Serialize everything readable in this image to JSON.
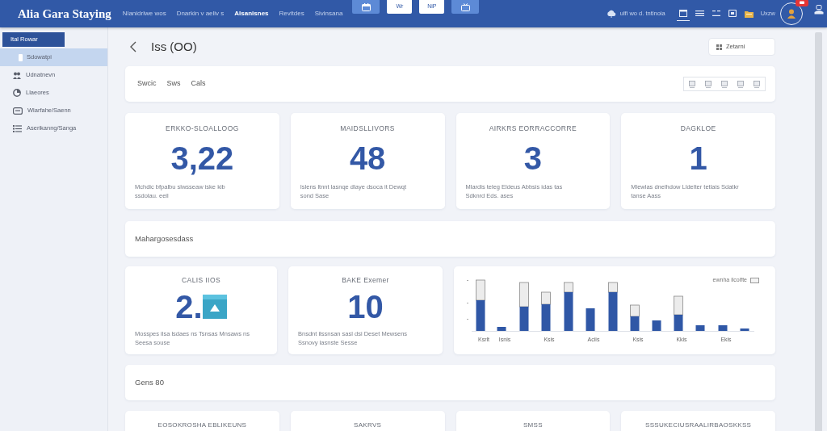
{
  "top_bar": {
    "logo": "Alia Gara Staying",
    "nav": [
      {
        "label": "Nlanidrlwe wos",
        "selected": false
      },
      {
        "label": "Dnarkin v aeliv s",
        "selected": false
      },
      {
        "label": "Alsanisnes",
        "selected": true
      },
      {
        "label": "Revitdes",
        "selected": false
      },
      {
        "label": "Sivinsana",
        "selected": false
      }
    ],
    "view_buttons": [
      {
        "kind": "icon"
      },
      {
        "kind": "text",
        "label": "Wr"
      },
      {
        "kind": "text",
        "label": "NiP"
      },
      {
        "kind": "icon"
      }
    ],
    "status": "ulfi wo d. tntlnoia",
    "tools": [
      {
        "selected": true
      },
      {
        "selected": false
      },
      {
        "selected": false
      },
      {
        "selected": false
      },
      {
        "selected": false
      }
    ],
    "user": "Uxzw"
  },
  "sidebar": {
    "heading": "Ital Rowar",
    "items": [
      {
        "label": "Sdowatpi",
        "selected": true
      },
      {
        "label": "Udnatnevn",
        "selected": false
      },
      {
        "label": "Llaeores",
        "selected": false
      },
      {
        "label": "Wlarfahe/Saenn",
        "selected": false
      },
      {
        "label": "Aserikanng/Sanga",
        "selected": false
      }
    ]
  },
  "page": {
    "title": "Iss (OO)",
    "action": "Zetarni",
    "tabs": [
      {
        "label": "Swcic",
        "selected": false
      },
      {
        "label": "Sws",
        "selected": false
      },
      {
        "label": "Cals",
        "selected": false
      }
    ]
  },
  "stats": [
    {
      "title": "ERKKO-SLOALLOOG",
      "value": "3,22",
      "description": "Mchdic bfpalbu slwsseaw iske kib ssdolau. eeil"
    },
    {
      "title": "MAIDSLLIVORS",
      "value": "48",
      "description": "Islens ltnnt lasnqe dlaye dsoca it Dewqt sond Sase"
    },
    {
      "title": "AIRKRS EORRACCORRE",
      "value": "3",
      "description": "Mlardis teleg Eldeus Abbsis idas tas Sdknrd Eds. ases"
    },
    {
      "title": "DAGKLOE",
      "value": "1",
      "description": "Mlewlas dnelhdow Lldelter tetlais Sdatkr tanse Aass"
    }
  ],
  "section_1": {
    "title": "Mahargosesdass",
    "cards": [
      {
        "kind": "image",
        "title": "CALIS IIOS",
        "value": "2.",
        "description": "Mosspes ilsa lsdaes ns Tsnsas Mnsaws ns Seesa souse"
      },
      {
        "kind": "number",
        "title": "BAKE Exemer",
        "value": "10",
        "description": "Bnsdnt ilssnsan sasl dsi Deset Mewsens Ssnovy lasnste Sesse"
      }
    ],
    "chart": {
      "legend": "ewnha ilcolfte",
      "x_labels": [
        "Ksrlt",
        "Isnis",
        "Ksis",
        "Aciis",
        "Ksis",
        "Kkis",
        "Ekis"
      ]
    }
  },
  "section_2": {
    "title": "Gens 80",
    "cards": [
      {
        "title": "EOSOKROSHA EBLIKEUNS"
      },
      {
        "title": "SAKRVS"
      },
      {
        "title": "SMSS"
      },
      {
        "title": "SSSUKECIUSRAALIRBAOSKKSS"
      }
    ]
  }
}
